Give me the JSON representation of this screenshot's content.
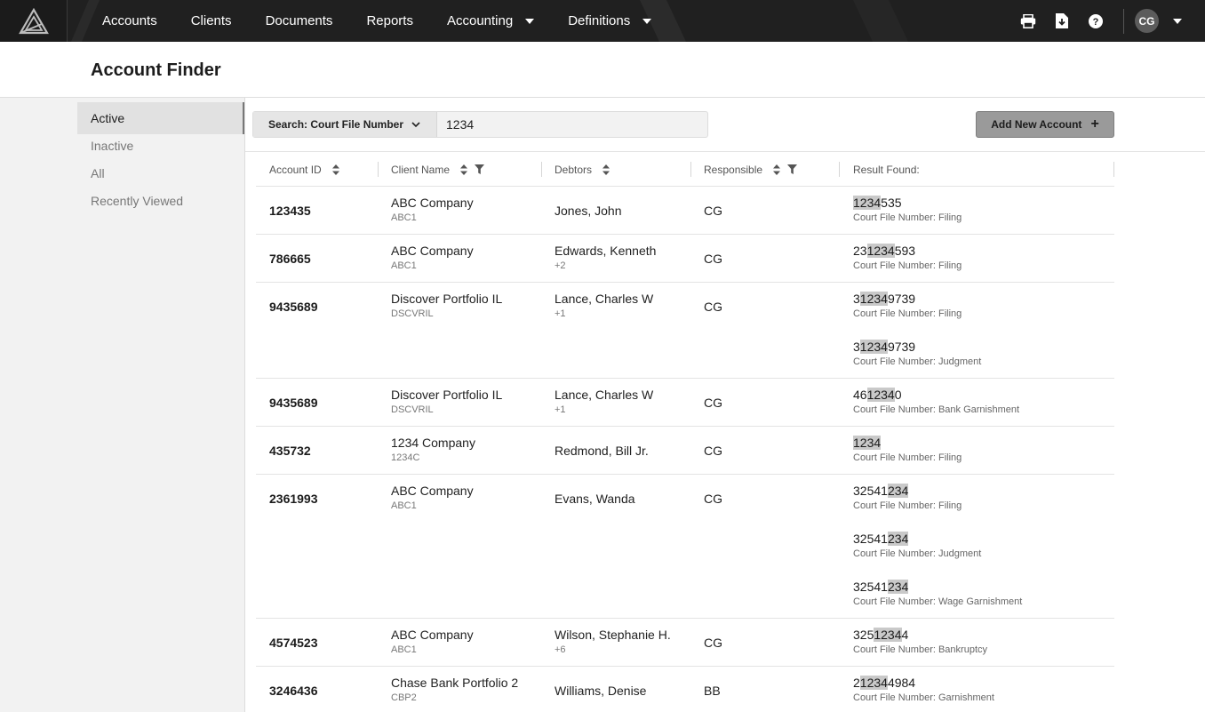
{
  "nav": {
    "items": [
      {
        "label": "Accounts",
        "dropdown": false
      },
      {
        "label": "Clients",
        "dropdown": false
      },
      {
        "label": "Documents",
        "dropdown": false
      },
      {
        "label": "Reports",
        "dropdown": false
      },
      {
        "label": "Accounting",
        "dropdown": true
      },
      {
        "label": "Definitions",
        "dropdown": true
      }
    ],
    "user_initials": "CG",
    "icons": [
      "print-icon",
      "download-file-icon",
      "help-icon"
    ]
  },
  "page": {
    "title": "Account Finder"
  },
  "sidebar": {
    "items": [
      {
        "label": "Active",
        "active": true
      },
      {
        "label": "Inactive",
        "active": false
      },
      {
        "label": "All",
        "active": false
      },
      {
        "label": "Recently Viewed",
        "active": false
      }
    ]
  },
  "toolbar": {
    "search_type_label": "Search: Court File Number",
    "search_value": "1234",
    "add_button_label": "Add New Account"
  },
  "table": {
    "columns": [
      {
        "label": "Account ID",
        "sortable": true,
        "filterable": false
      },
      {
        "label": "Client Name",
        "sortable": true,
        "filterable": true
      },
      {
        "label": "Debtors",
        "sortable": true,
        "filterable": false
      },
      {
        "label": "Responsible",
        "sortable": true,
        "filterable": true
      },
      {
        "label": "Result Found:",
        "sortable": false,
        "filterable": false
      }
    ],
    "rows": [
      {
        "account_id": "123435",
        "client_name": "ABC Company",
        "client_code": "ABC1",
        "debtor": "Jones, John",
        "debtor_extra": "",
        "responsible": "CG",
        "results": [
          {
            "pre": "",
            "match": "1234",
            "post": "535",
            "type": "Court File Number: Filing"
          }
        ]
      },
      {
        "account_id": "786665",
        "client_name": "ABC Company",
        "client_code": "ABC1",
        "debtor": "Edwards, Kenneth",
        "debtor_extra": "+2",
        "responsible": "CG",
        "results": [
          {
            "pre": "23",
            "match": "1234",
            "post": "593",
            "type": "Court File Number: Filing"
          }
        ]
      },
      {
        "account_id": "9435689",
        "client_name": "Discover Portfolio IL",
        "client_code": "DSCVRIL",
        "debtor": "Lance, Charles W",
        "debtor_extra": "+1",
        "responsible": "CG",
        "results": [
          {
            "pre": "3",
            "match": "1234",
            "post": "9739",
            "type": "Court File Number: Filing"
          },
          {
            "pre": "3",
            "match": "1234",
            "post": "9739",
            "type": "Court File Number: Judgment"
          }
        ]
      },
      {
        "account_id": "9435689",
        "client_name": "Discover Portfolio IL",
        "client_code": "DSCVRIL",
        "debtor": "Lance, Charles W",
        "debtor_extra": "+1",
        "responsible": "CG",
        "results": [
          {
            "pre": "46",
            "match": "1234",
            "post": "0",
            "type": "Court File Number: Bank Garnishment"
          }
        ]
      },
      {
        "account_id": "435732",
        "client_name": "1234 Company",
        "client_code": "1234C",
        "debtor": "Redmond, Bill Jr.",
        "debtor_extra": "",
        "responsible": "CG",
        "results": [
          {
            "pre": "",
            "match": "1234",
            "post": "",
            "type": "Court File Number: Filing"
          }
        ]
      },
      {
        "account_id": "2361993",
        "client_name": "ABC Company",
        "client_code": "ABC1",
        "debtor": "Evans, Wanda",
        "debtor_extra": "",
        "responsible": "CG",
        "results": [
          {
            "pre": "32541",
            "match": "234",
            "post": "",
            "type": "Court File Number: Filing"
          },
          {
            "pre": "32541",
            "match": "234",
            "post": "",
            "type": "Court File Number: Judgment"
          },
          {
            "pre": "32541",
            "match": "234",
            "post": "",
            "type": "Court File Number: Wage Garnishment"
          }
        ]
      },
      {
        "account_id": "4574523",
        "client_name": "ABC Company",
        "client_code": "ABC1",
        "debtor": "Wilson, Stephanie H.",
        "debtor_extra": "+6",
        "responsible": "CG",
        "results": [
          {
            "pre": "325",
            "match": "1234",
            "post": "4",
            "type": "Court File Number: Bankruptcy"
          }
        ]
      },
      {
        "account_id": "3246436",
        "client_name": "Chase Bank Portfolio 2",
        "client_code": "CBP2",
        "debtor": "Williams, Denise",
        "debtor_extra": "",
        "responsible": "BB",
        "results": [
          {
            "pre": "2",
            "match": "1234",
            "post": "4984",
            "type": "Court File Number: Garnishment"
          }
        ]
      }
    ]
  }
}
